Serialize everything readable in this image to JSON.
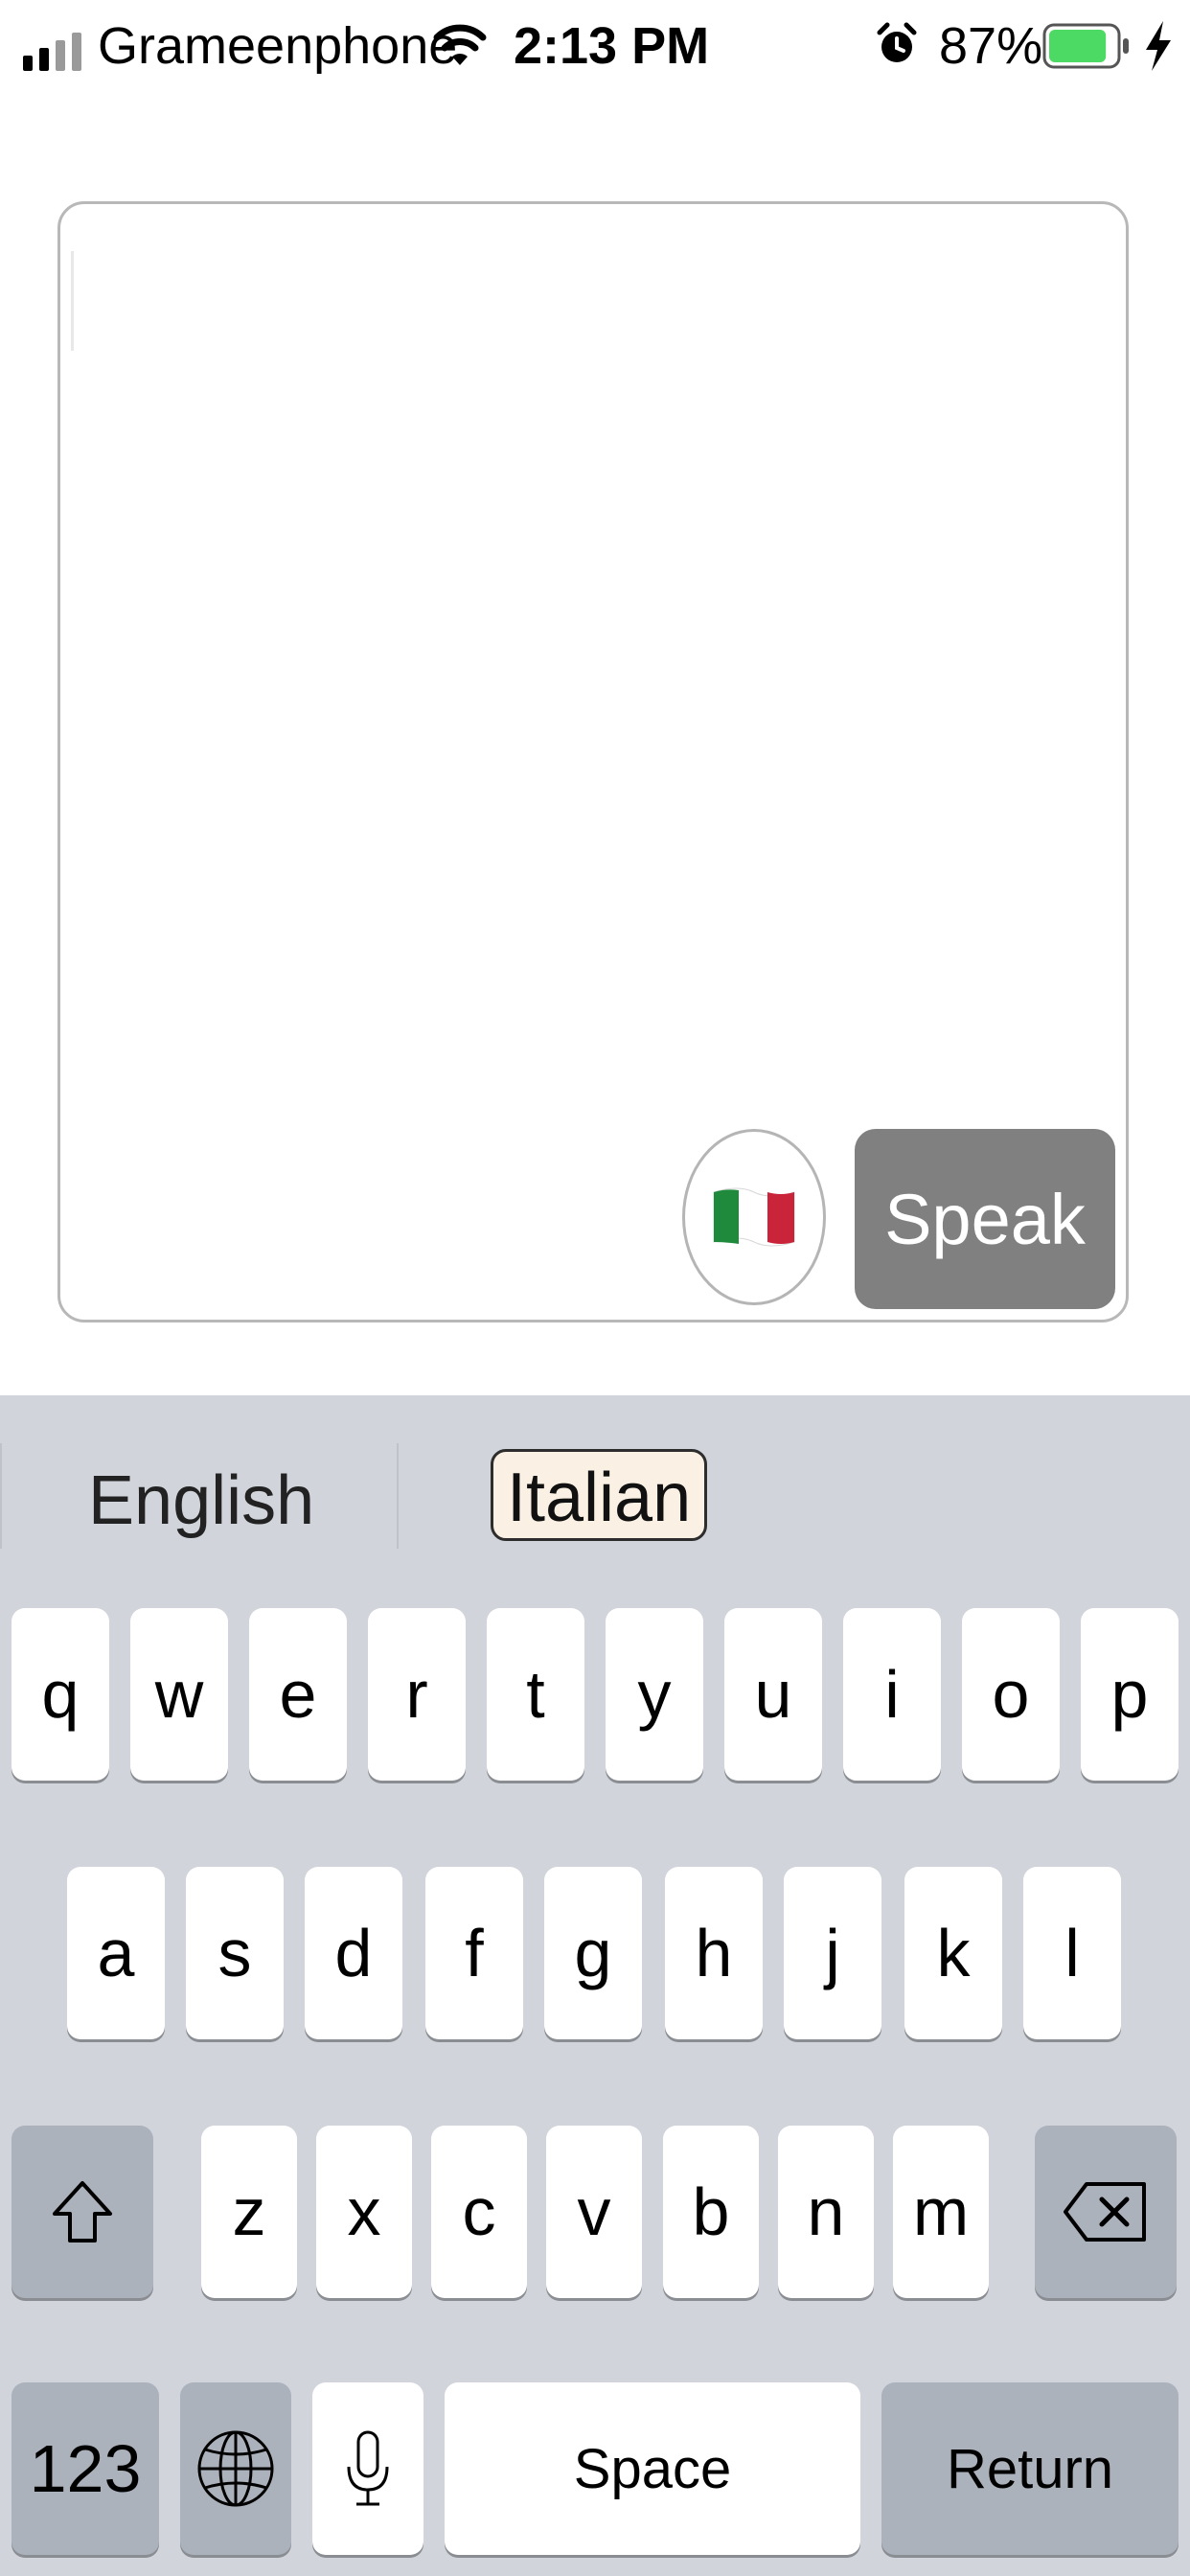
{
  "status_bar": {
    "carrier": "Grameenphone",
    "time": "2:13 PM",
    "battery_percent": "87%",
    "battery_level": 0.87,
    "icons": [
      "signal-icon",
      "wifi-icon",
      "alarm-icon",
      "battery-icon",
      "charging-bolt-icon"
    ]
  },
  "editor": {
    "text": "",
    "language_flag": "italy-flag-icon",
    "speak_label": "Speak"
  },
  "keyboard": {
    "predictions": [
      "English",
      "Italian"
    ],
    "selected_prediction": "Italian",
    "row1": [
      "q",
      "w",
      "e",
      "r",
      "t",
      "y",
      "u",
      "i",
      "o",
      "p"
    ],
    "row2": [
      "a",
      "s",
      "d",
      "f",
      "g",
      "h",
      "j",
      "k",
      "l"
    ],
    "row3": [
      "z",
      "x",
      "c",
      "v",
      "b",
      "n",
      "m"
    ],
    "numbers_label": "123",
    "space_label": "Space",
    "return_label": "Return",
    "icons": [
      "shift-icon",
      "backspace-icon",
      "globe-icon",
      "microphone-icon"
    ]
  }
}
